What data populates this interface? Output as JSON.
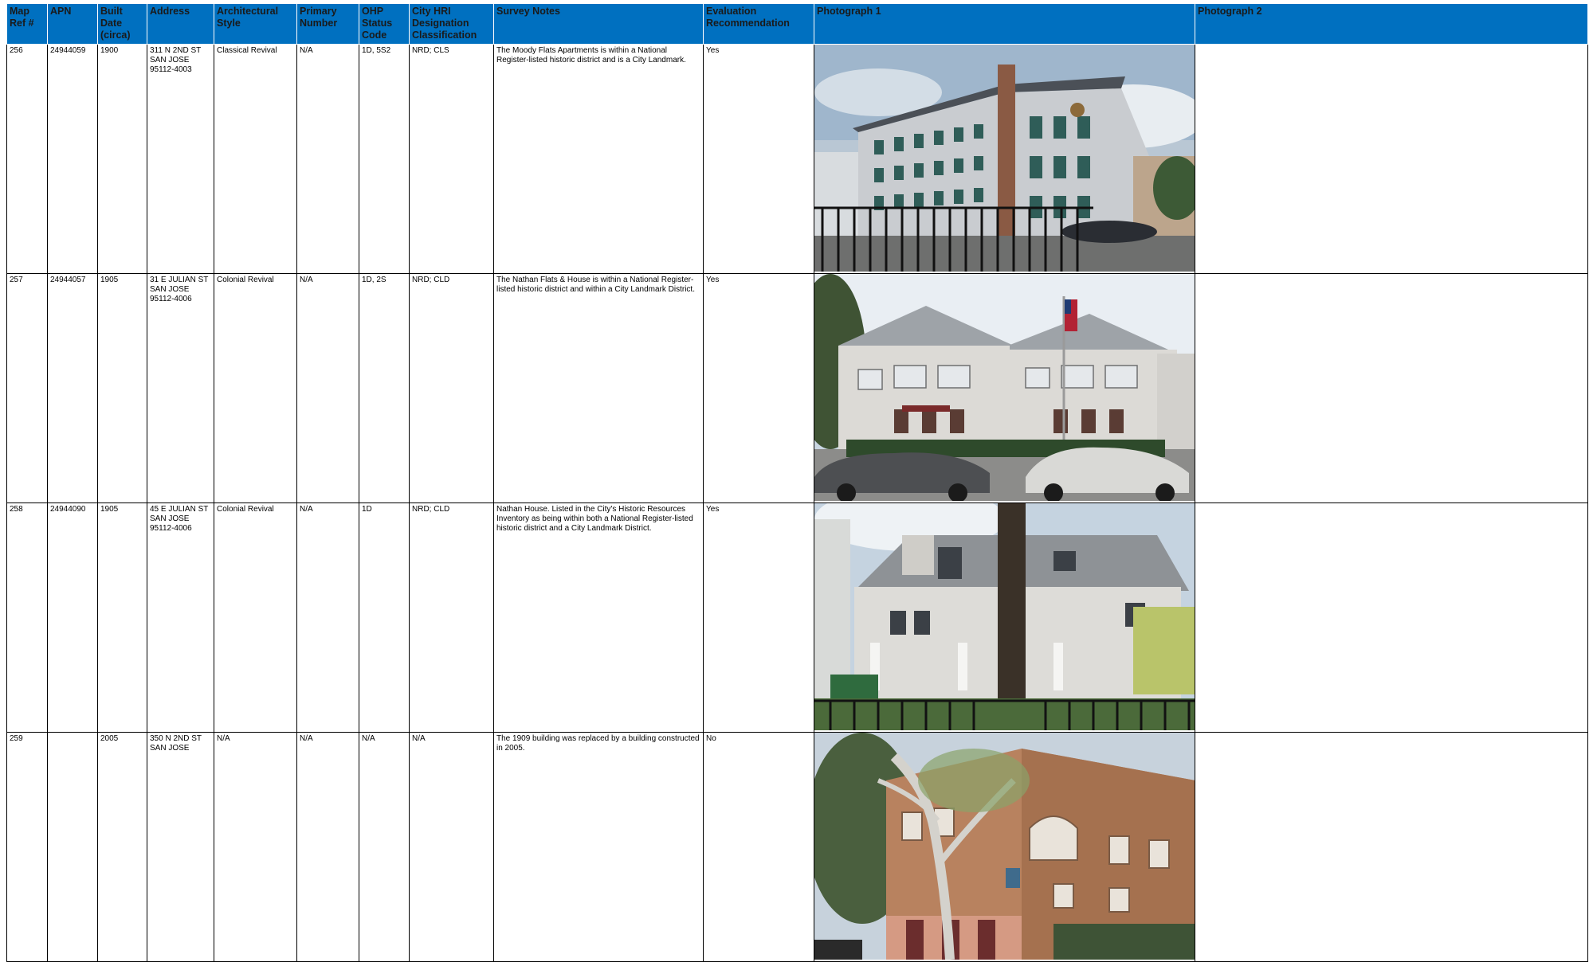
{
  "headers": {
    "map_ref": "Map Ref #",
    "apn": "APN",
    "built_date": "Built Date (circa)",
    "address": "Address",
    "arch_style": "Architectural Style",
    "primary_number": "Primary Number",
    "ohp_status": "OHP Status Code",
    "city_hri": "City HRI Designation Classification",
    "survey_notes": "Survey Notes",
    "evaluation": "Evaluation Recommendation",
    "photo1": "Photograph 1",
    "photo2": "Photograph 2"
  },
  "rows": [
    {
      "map_ref": "256",
      "apn": "24944059",
      "built_date": "1900",
      "address": [
        "311 N 2ND ST",
        "SAN JOSE",
        "95112-4003"
      ],
      "arch_style": "Classical Revival",
      "primary_number": "N/A",
      "ohp_status": "1D, 5S2",
      "city_hri": "NRD; CLS",
      "survey_notes": "The Moody Flats Apartments is within a National Register-listed historic district and is a City Landmark.",
      "evaluation": "Yes",
      "photo1": "photo-moody-flats"
    },
    {
      "map_ref": "257",
      "apn": "24944057",
      "built_date": "1905",
      "address": [
        "31 E JULIAN ST",
        "SAN JOSE",
        "95112-4006"
      ],
      "arch_style": "Colonial Revival",
      "primary_number": "N/A",
      "ohp_status": "1D, 2S",
      "city_hri": "NRD; CLD",
      "survey_notes": "The Nathan Flats & House is within a National Register-listed historic district and within a City Landmark District.",
      "evaluation": "Yes",
      "photo1": "photo-nathan-flats"
    },
    {
      "map_ref": "258",
      "apn": "24944090",
      "built_date": "1905",
      "address": [
        "45 E JULIAN ST",
        "SAN JOSE",
        "95112-4006"
      ],
      "arch_style": "Colonial Revival",
      "primary_number": "N/A",
      "ohp_status": "1D",
      "city_hri": "NRD; CLD",
      "survey_notes": "Nathan House. Listed in the City's Historic Resources Inventory as being within both a National Register-listed historic district and a City Landmark District.",
      "evaluation": "Yes",
      "photo1": "photo-nathan-house"
    },
    {
      "map_ref": "259",
      "apn": "",
      "built_date": "2005",
      "address": [
        "350 N 2ND ST",
        "SAN JOSE"
      ],
      "arch_style": "N/A",
      "primary_number": "N/A",
      "ohp_status": "N/A",
      "city_hri": "N/A",
      "survey_notes": "The 1909 building was replaced by a building constructed in 2005.",
      "evaluation": "No",
      "photo1": "photo-2005-building"
    }
  ],
  "colors": {
    "header_bg": "#0070c0",
    "header_text": "#1a1a1a",
    "border": "#000000"
  }
}
